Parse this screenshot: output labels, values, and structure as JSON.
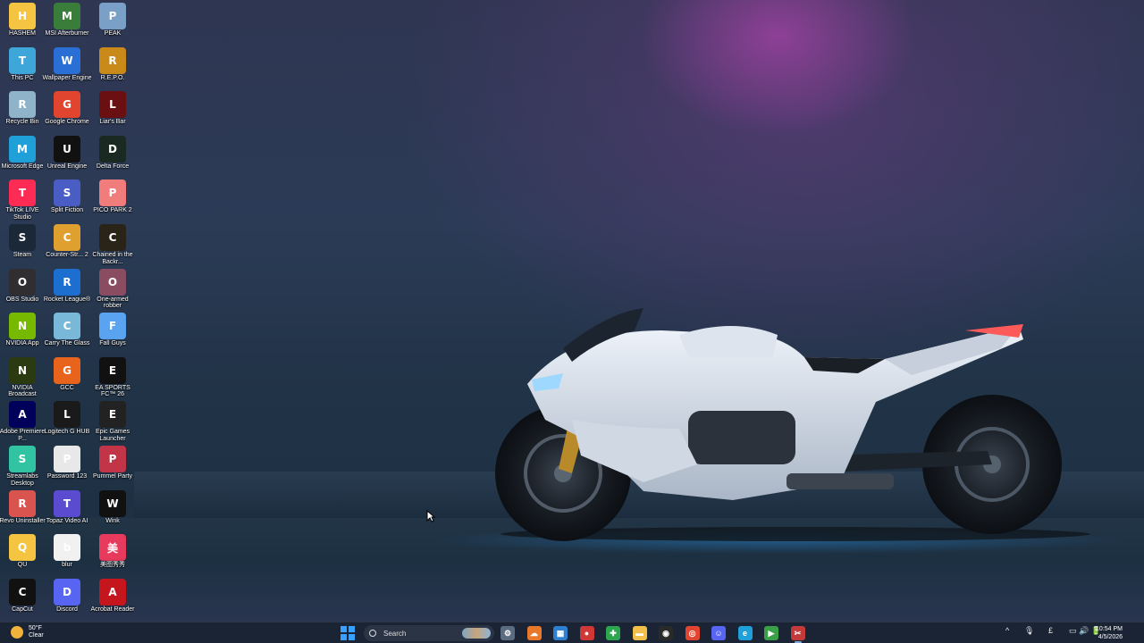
{
  "desktop": {
    "icons": [
      {
        "label": "HASHEM",
        "icon": "folder-icon",
        "color": "#f5c542"
      },
      {
        "label": "This PC",
        "icon": "monitor-icon",
        "color": "#3fa6d9"
      },
      {
        "label": "Recycle Bin",
        "icon": "recycle-bin-icon",
        "color": "#8fb3c9"
      },
      {
        "label": "Microsoft Edge",
        "icon": "edge-icon",
        "color": "#1fa0d8"
      },
      {
        "label": "TikTok LIVE Studio",
        "icon": "tiktok-icon",
        "color": "#fe2c55"
      },
      {
        "label": "Steam",
        "icon": "steam-icon",
        "color": "#1b2838"
      },
      {
        "label": "OBS Studio",
        "icon": "obs-icon",
        "color": "#302e31"
      },
      {
        "label": "NVIDIA App",
        "icon": "nvidia-icon",
        "color": "#76b900"
      },
      {
        "label": "NVIDIA Broadcast",
        "icon": "nvidia-broadcast-icon",
        "color": "#2b3a10"
      },
      {
        "label": "Adobe Premiere P...",
        "icon": "premiere-icon",
        "color": "#00005b"
      },
      {
        "label": "Streamlabs Desktop",
        "icon": "streamlabs-icon",
        "color": "#31c3a2"
      },
      {
        "label": "Revo Uninstaller",
        "icon": "revo-icon",
        "color": "#d9534f"
      },
      {
        "label": "QU",
        "icon": "folder-icon",
        "color": "#f5c542"
      },
      {
        "label": "CapCut",
        "icon": "capcut-icon",
        "color": "#111111"
      },
      {
        "label": "MSI Afterburner",
        "icon": "msi-afterburner-icon",
        "color": "#3a7d3a"
      },
      {
        "label": "Wallpaper Engine",
        "icon": "wallpaper-engine-icon",
        "color": "#2a6fd6"
      },
      {
        "label": "Google Chrome",
        "icon": "chrome-icon",
        "color": "#e2452f"
      },
      {
        "label": "Unreal Engine",
        "icon": "unreal-icon",
        "color": "#111111"
      },
      {
        "label": "Split Fiction",
        "icon": "split-fiction-icon",
        "color": "#4a5dc4"
      },
      {
        "label": "Counter-Str... 2",
        "icon": "counter-strike-icon",
        "color": "#e0a030"
      },
      {
        "label": "Rocket League®",
        "icon": "rocket-league-icon",
        "color": "#1c6ecf"
      },
      {
        "label": "Carry The Glass",
        "icon": "carry-the-glass-icon",
        "color": "#7ab8d9"
      },
      {
        "label": "GCC",
        "icon": "gcc-icon",
        "color": "#e8641c"
      },
      {
        "label": "Logitech G HUB",
        "icon": "logitech-icon",
        "color": "#1a1a1a"
      },
      {
        "label": "Password 123",
        "icon": "text-file-icon",
        "color": "#e8e8e8"
      },
      {
        "label": "Topaz Video AI",
        "icon": "topaz-icon",
        "color": "#5b4bd1"
      },
      {
        "label": "blur",
        "icon": "blur-icon",
        "color": "#f1f1f1"
      },
      {
        "label": "Discord",
        "icon": "discord-icon",
        "color": "#5865f2"
      },
      {
        "label": "PEAK",
        "icon": "peak-icon",
        "color": "#7aa0c8"
      },
      {
        "label": "R.E.P.O.",
        "icon": "repo-icon",
        "color": "#c98a1a"
      },
      {
        "label": "Liar's Bar",
        "icon": "liars-bar-icon",
        "color": "#6a0f12"
      },
      {
        "label": "Delta Force",
        "icon": "delta-force-icon",
        "color": "#1a2a22"
      },
      {
        "label": "PICO PARK 2",
        "icon": "pico-park-icon",
        "color": "#f07c7c"
      },
      {
        "label": "Chained in the Backr...",
        "icon": "chained-icon",
        "color": "#2a2418"
      },
      {
        "label": "One-armed robber",
        "icon": "one-armed-robber-icon",
        "color": "#8a4c60"
      },
      {
        "label": "Fall Guys",
        "icon": "fall-guys-icon",
        "color": "#5aa3f0"
      },
      {
        "label": "EA SPORTS FC™ 26",
        "icon": "ea-sports-fc-icon",
        "color": "#111111"
      },
      {
        "label": "Epic Games Launcher",
        "icon": "epic-games-icon",
        "color": "#222222"
      },
      {
        "label": "Pummel Party",
        "icon": "pummel-party-icon",
        "color": "#c23448"
      },
      {
        "label": "Wink",
        "icon": "wink-icon",
        "color": "#111111"
      },
      {
        "label": "美图秀秀",
        "icon": "meitu-icon",
        "color": "#e83a5c"
      },
      {
        "label": "Acrobat Reader",
        "icon": "acrobat-icon",
        "color": "#c4161c"
      }
    ]
  },
  "taskbar": {
    "weather": {
      "temp": "50°F",
      "condition": "Clear",
      "icon": "moon-icon"
    },
    "search_placeholder": "Search",
    "pinned": [
      {
        "name": "settings-app-icon",
        "glyph": "⚙",
        "color": "#5b6b80"
      },
      {
        "name": "cloud-app-icon",
        "glyph": "☁",
        "color": "#e8792b"
      },
      {
        "name": "photos-app-icon",
        "glyph": "▦",
        "color": "#2f7fd0"
      },
      {
        "name": "record-app-icon",
        "glyph": "●",
        "color": "#d03838"
      },
      {
        "name": "xbox-app-icon",
        "glyph": "✚",
        "color": "#2da44e"
      },
      {
        "name": "file-explorer-icon",
        "glyph": "▬",
        "color": "#f0c04a"
      },
      {
        "name": "webcam-app-icon",
        "glyph": "◉",
        "color": "#2a2a2a"
      },
      {
        "name": "chrome-taskbar-icon",
        "glyph": "◎",
        "color": "#e2452f"
      },
      {
        "name": "discord-taskbar-icon",
        "glyph": "☺",
        "color": "#5865f2"
      },
      {
        "name": "edge-taskbar-icon",
        "glyph": "e",
        "color": "#1fa0d8"
      },
      {
        "name": "play-app-icon",
        "glyph": "▶",
        "color": "#3aa047"
      },
      {
        "name": "snipping-app-icon",
        "glyph": "✂",
        "color": "#c33a3a"
      }
    ],
    "tray": {
      "chevron": "^",
      "mic": "🎙",
      "lang": "£",
      "icons": "▭ 🔊 🔋"
    },
    "clock": {
      "time": "10:54 PM",
      "date": "4/5/2026"
    }
  }
}
